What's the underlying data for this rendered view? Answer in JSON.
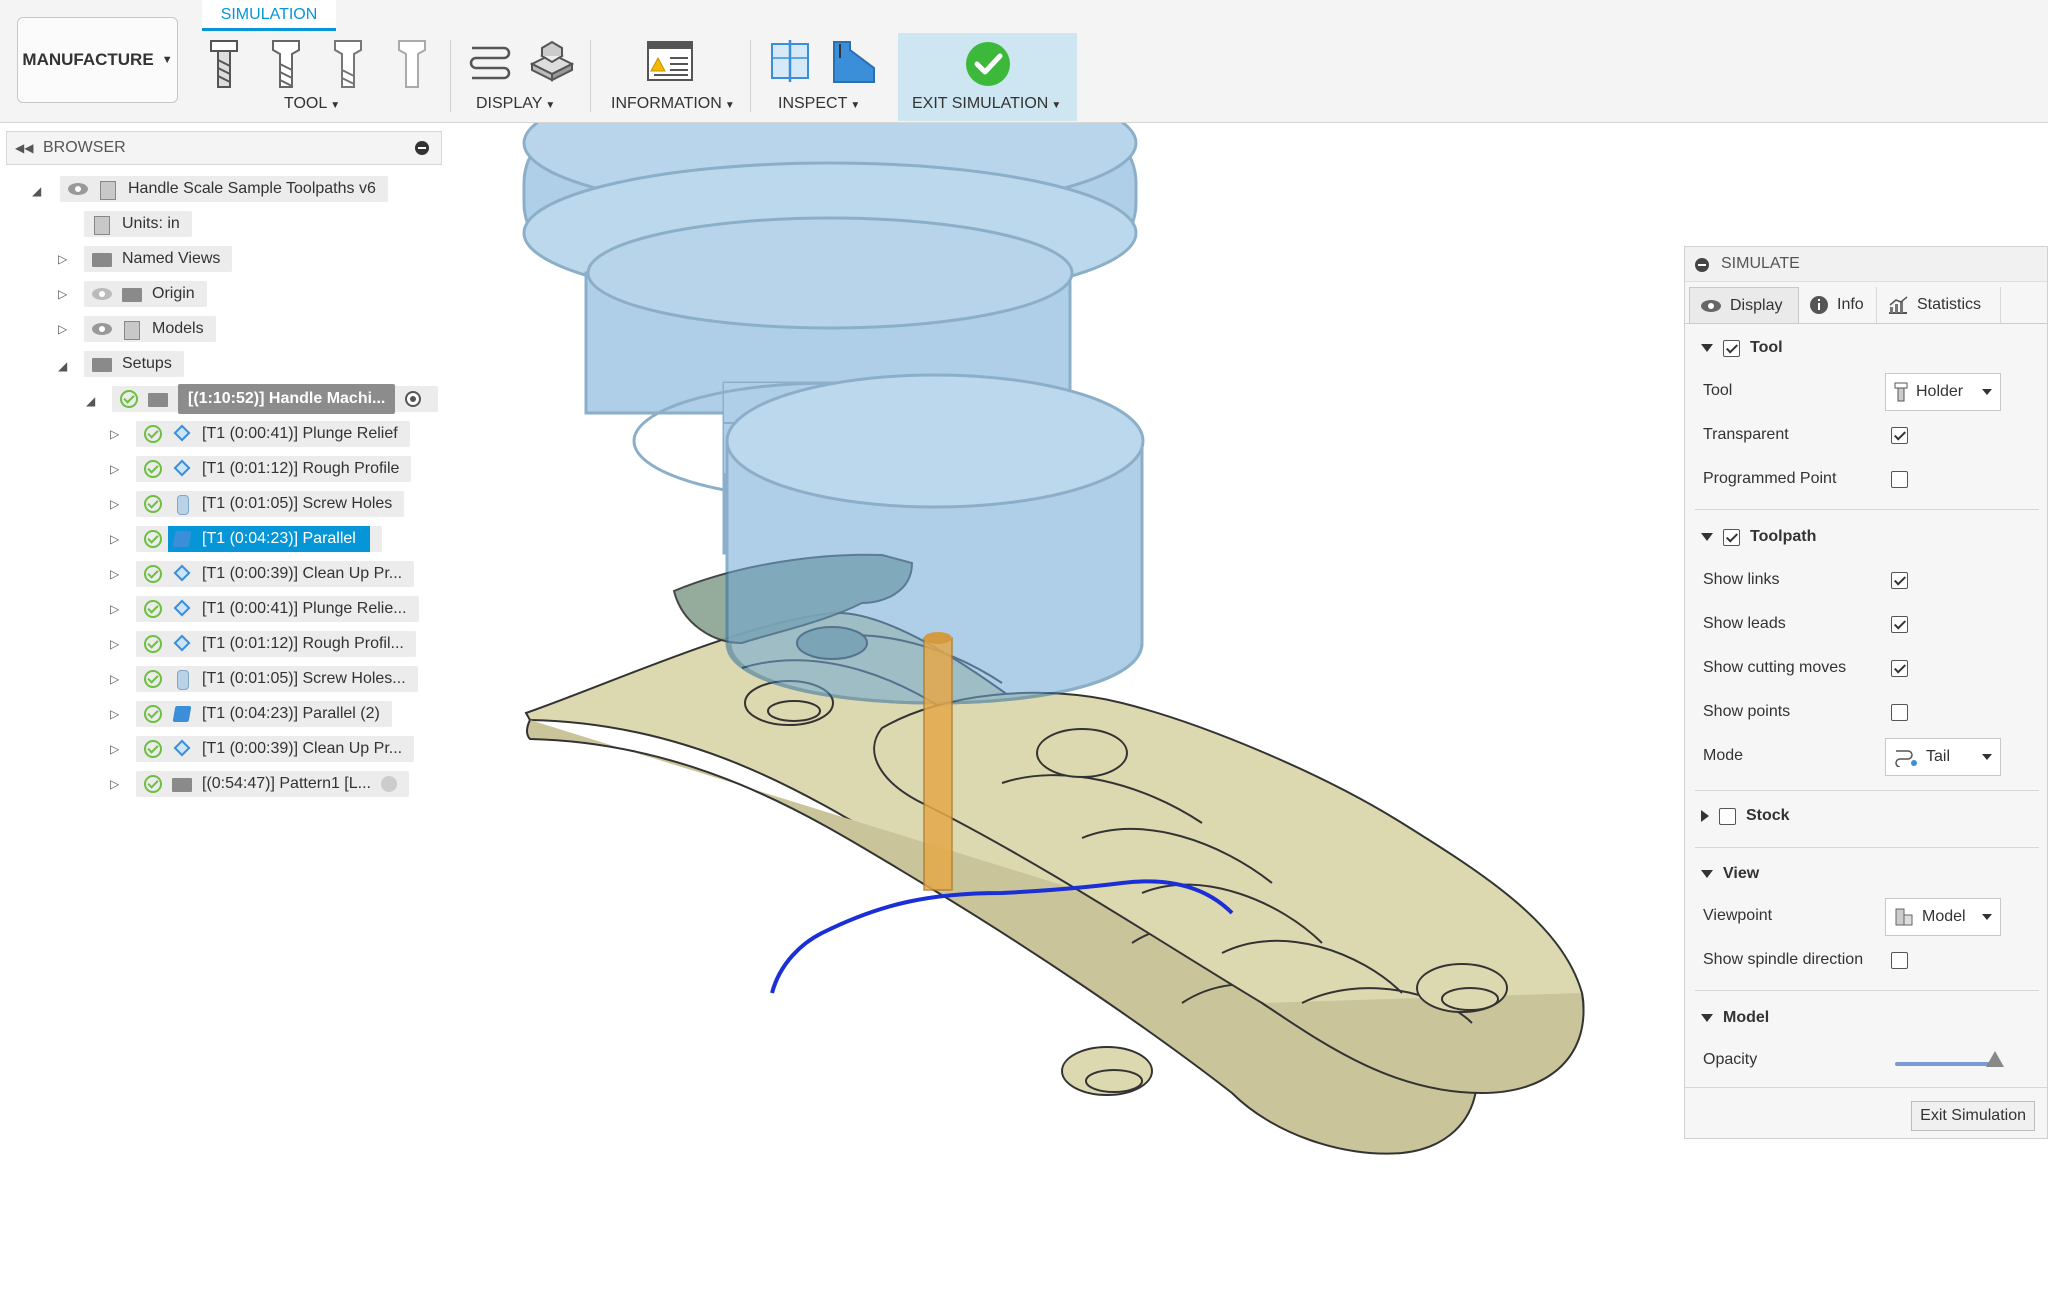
{
  "toolbar": {
    "workspace": "MANUFACTURE",
    "active_tab": "SIMULATION",
    "groups": {
      "tool": "TOOL",
      "display": "DISPLAY",
      "information": "INFORMATION",
      "inspect": "INSPECT",
      "exit_simulation": "EXIT SIMULATION"
    }
  },
  "browser": {
    "title": "BROWSER",
    "root": "Handle Scale Sample Toolpaths v6",
    "units": "Units: in",
    "named_views": "Named Views",
    "origin": "Origin",
    "models": "Models",
    "setups": "Setups",
    "setup": "[(1:10:52)] Handle Machi...",
    "operations": [
      {
        "label": "[T1 (0:00:41)] Plunge Relief",
        "icon": "op-icon"
      },
      {
        "label": "[T1 (0:01:12)] Rough Profile",
        "icon": "op-icon"
      },
      {
        "label": "[T1 (0:01:05)] Screw Holes",
        "icon": "drill-icon"
      },
      {
        "label": "[T1 (0:04:23)] Parallel",
        "icon": "parallel-icon"
      },
      {
        "label": "[T1 (0:00:39)] Clean Up Pr...",
        "icon": "op-icon"
      },
      {
        "label": "[T1 (0:00:41)] Plunge Relie...",
        "icon": "op-icon"
      },
      {
        "label": "[T1 (0:01:12)] Rough Profil...",
        "icon": "op-icon"
      },
      {
        "label": "[T1 (0:01:05)] Screw Holes...",
        "icon": "drill-icon"
      },
      {
        "label": "[T1 (0:04:23)] Parallel (2)",
        "icon": "parallel-icon"
      },
      {
        "label": "[T1 (0:00:39)] Clean Up Pr...",
        "icon": "op-icon"
      },
      {
        "label": "[(0:54:47)] Pattern1 [L...",
        "icon": "pattern-icon"
      }
    ]
  },
  "simulate": {
    "title": "SIMULATE",
    "tabs": [
      "Display",
      "Info",
      "Statistics"
    ],
    "tool_section": "Tool",
    "tool_label": "Tool",
    "tool_value": "Holder",
    "transparent": "Transparent",
    "programmed_point": "Programmed Point",
    "toolpath_section": "Toolpath",
    "show_links": "Show links",
    "show_leads": "Show leads",
    "show_cutting_moves": "Show cutting moves",
    "show_points": "Show points",
    "mode_label": "Mode",
    "mode_value": "Tail",
    "stock_section": "Stock",
    "view_section": "View",
    "viewpoint_label": "Viewpoint",
    "viewpoint_value": "Model",
    "show_spindle_direction": "Show spindle direction",
    "model_section": "Model",
    "opacity_label": "Opacity",
    "opacity_value": 1.0,
    "exit_button": "Exit Simulation",
    "checks": {
      "tool": true,
      "transparent": true,
      "programmed_point": false,
      "toolpath": true,
      "show_links": true,
      "show_leads": true,
      "show_cutting_moves": true,
      "show_points": false,
      "stock": false,
      "show_spindle_direction": false
    }
  },
  "colors": {
    "accent": "#0696d7",
    "exit_highlight": "#cde6f2",
    "success_green": "#6cbf3f",
    "part_fill": "#dcd8b0",
    "holder_blue": "#6fa8d6",
    "toolpath_blue": "#1a2fd6",
    "tool_orange": "#e5a94a"
  }
}
